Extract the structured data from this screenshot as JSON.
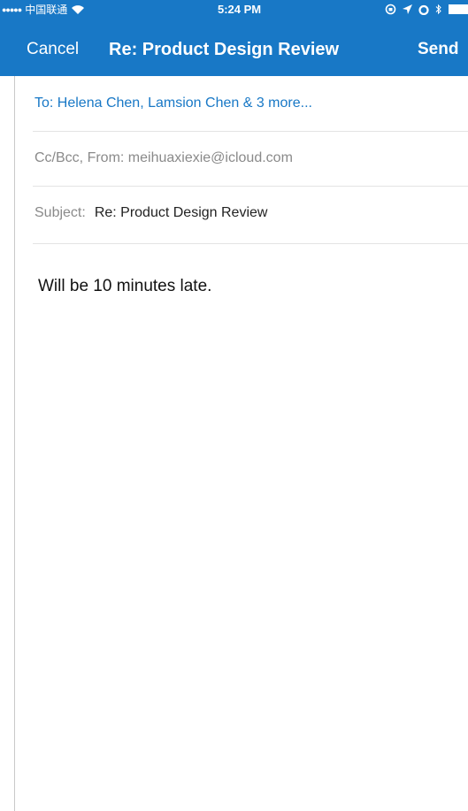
{
  "status_bar": {
    "carrier": "中国联通",
    "signal_dots": "●●●●●",
    "time": "5:24 PM",
    "icons": [
      "wifi-icon",
      "orientation-lock-icon",
      "location-icon",
      "alarm-icon",
      "bluetooth-icon",
      "battery-icon"
    ]
  },
  "nav": {
    "cancel_label": "Cancel",
    "title": "Re: Product Design Review",
    "send_label": "Send"
  },
  "fields": {
    "to_label": "To:",
    "to_value": "Helena Chen, Lamsion Chen & 3 more...",
    "cc_from_label": "Cc/Bcc, From:",
    "from_value": "meihuaxiexie@icloud.com",
    "subject_label": "Subject:",
    "subject_value": "Re: Product Design Review"
  },
  "body": {
    "text": "Will be 10 minutes late."
  },
  "colors": {
    "accent": "#1878c6",
    "muted_label": "#8a8a8a",
    "divider": "#e3e3e3"
  }
}
